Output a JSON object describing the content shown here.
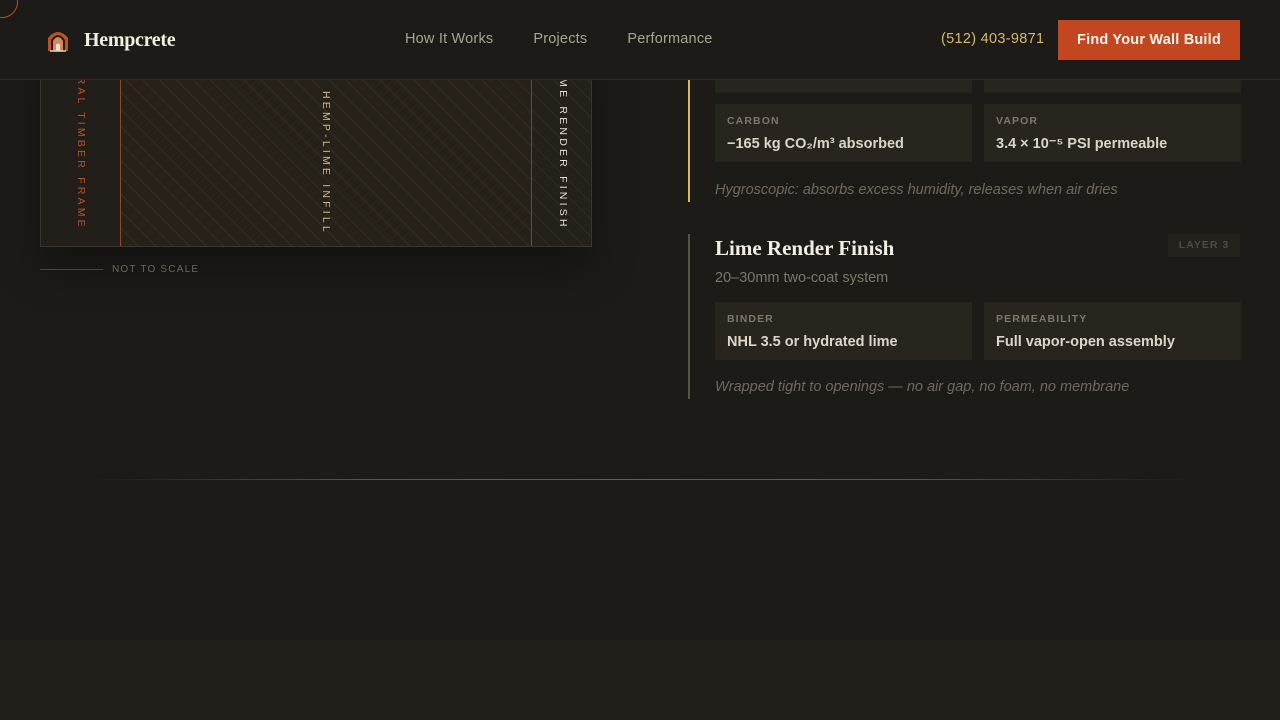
{
  "header": {
    "brand": "Hempcrete",
    "nav": [
      "How It Works",
      "Projects",
      "Performance"
    ],
    "phone": "(512) 403-9871",
    "cta": "Find Your Wall Build"
  },
  "diagram": {
    "labels": {
      "timber": "STRUCTURAL TIMBER FRAME",
      "infill": "HEMP-LIME INFILL",
      "render": "LIME RENDER FINISH"
    },
    "scale_note": "NOT TO SCALE"
  },
  "layers": [
    {
      "cards": [
        {
          "label": "Carbon",
          "value": "−165 kg CO₂/m³ absorbed"
        },
        {
          "label": "Vapor",
          "value": "3.4 × 10⁻⁵ PSI permeable"
        }
      ],
      "note": "Hygroscopic: absorbs excess humidity, releases when air dries"
    },
    {
      "title": "Lime Render Finish",
      "tag": "LAYER 3",
      "subtitle": "20–30mm two-coat system",
      "cards": [
        {
          "label": "Binder",
          "value": "NHL 3.5 or hydrated lime"
        },
        {
          "label": "Permeability",
          "value": "Full vapor-open assembly"
        }
      ],
      "note": "Wrapped tight to openings — no air gap, no foam, no membrane"
    }
  ],
  "colors": {
    "accent": "#c2461f",
    "gold": "#d8b968",
    "background": "#1d1b18"
  }
}
